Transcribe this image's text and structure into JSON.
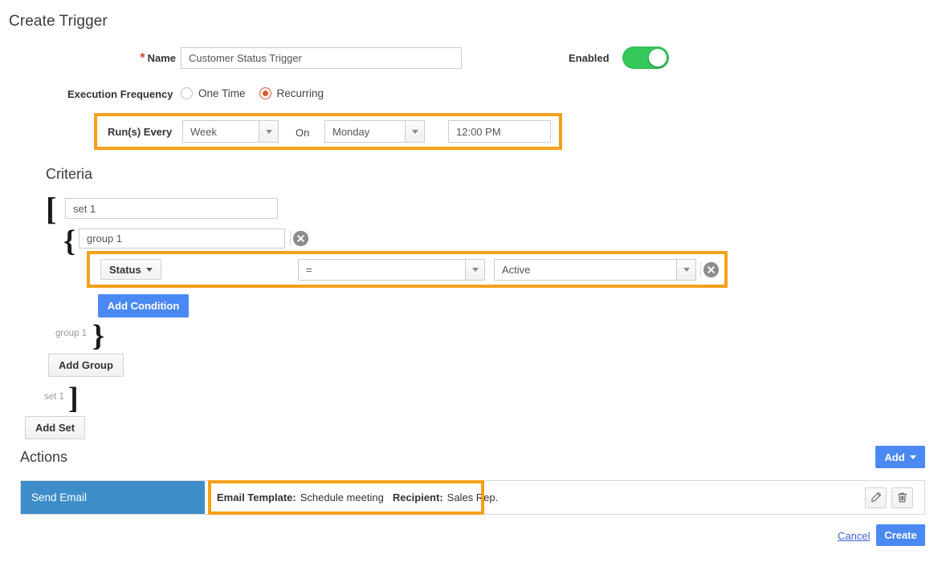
{
  "page": {
    "title": "Create Trigger"
  },
  "form": {
    "name_label": "Name",
    "name_required_mark": "*",
    "name_value": "Customer Status Trigger",
    "name_placeholder": "Name",
    "enabled_label": "Enabled",
    "enabled_state": "on",
    "frequency_label": "Execution Frequency",
    "frequency_options": [
      "One Time",
      "Recurring"
    ],
    "frequency_selected": "Recurring"
  },
  "schedule": {
    "runs_every_label": "Run(s) Every",
    "interval_value": "Week",
    "on_label": "On",
    "day_value": "Monday",
    "time_value": "12:00 PM",
    "highlighted": true
  },
  "criteria": {
    "heading": "Criteria",
    "set_name": "set 1",
    "set_open_bracket": "[",
    "set_close_bracket": "]",
    "set_close_label": "set 1",
    "group_name": "group 1",
    "group_open_brace": "{",
    "group_close_brace": "}",
    "group_close_label": "group 1",
    "remove_icon": "close-circle-icon",
    "condition": {
      "field_label": "Status",
      "field_caret": "chevron-down-icon",
      "operator_value": "=",
      "value_value": "Active",
      "remove_icon": "close-circle-icon",
      "highlighted": true
    },
    "add_condition_label": "Add Condition",
    "add_group_label": "Add Group",
    "add_set_label": "Add Set"
  },
  "actions": {
    "heading": "Actions",
    "add_label": "Add",
    "add_caret": "chevron-down-icon",
    "rows": [
      {
        "type": "Send Email",
        "detail_label_1": "Email Template:",
        "detail_value_1": "Schedule meeting",
        "detail_label_2": "Recipient:",
        "detail_value_2": "Sales Rep.",
        "edit_icon": "pencil-icon",
        "delete_icon": "trash-icon",
        "highlighted": true
      }
    ]
  },
  "footer": {
    "cancel_label": "Cancel",
    "create_label": "Create"
  },
  "colors": {
    "highlight_orange": "#f5a01a",
    "primary_blue": "#4a89f3",
    "action_blue": "#3d8dc9",
    "toggle_green": "#34c759",
    "radio_orange": "#d9582c",
    "required_red": "#d9382c",
    "link_blue": "#3b63d8"
  }
}
